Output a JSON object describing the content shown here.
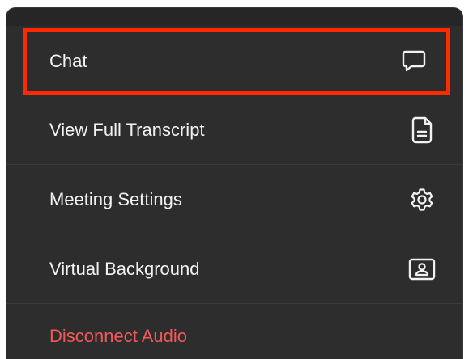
{
  "menu": {
    "items": [
      {
        "id": "chat",
        "label": "Chat",
        "icon": "chat-bubble-icon"
      },
      {
        "id": "transcript",
        "label": "View Full Transcript",
        "icon": "document-icon"
      },
      {
        "id": "settings",
        "label": "Meeting Settings",
        "icon": "gear-icon"
      },
      {
        "id": "background",
        "label": "Virtual Background",
        "icon": "person-frame-icon"
      },
      {
        "id": "disconnect",
        "label": "Disconnect Audio",
        "icon": ""
      }
    ]
  },
  "colors": {
    "panel_bg": "#2d2d2d",
    "text": "#f2f2f2",
    "danger_text": "#f25a5a",
    "highlight_border": "#ff2a00"
  }
}
